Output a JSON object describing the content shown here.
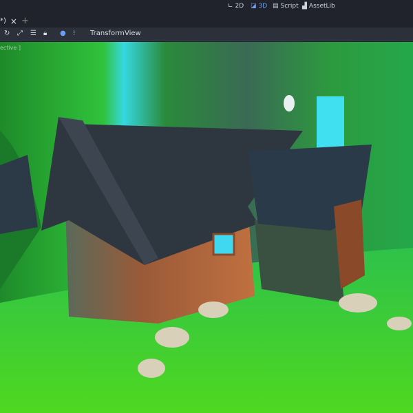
{
  "workspaces": [
    {
      "label": "2D",
      "icon": "2d-icon"
    },
    {
      "label": "3D",
      "icon": "3d-icon",
      "active": true
    },
    {
      "label": "Script",
      "icon": "script-icon"
    },
    {
      "label": "AssetLib",
      "icon": "assetlib-icon"
    }
  ],
  "tab": {
    "label": "*)",
    "close": "×",
    "add": "+"
  },
  "toolbar": {
    "menus": [
      "Transform",
      "View"
    ]
  },
  "viewport": {
    "label": "ective ]"
  },
  "colors": {
    "accent": "#6d9ff0",
    "toolbar": "#2b303b",
    "topbar": "#20232c"
  }
}
